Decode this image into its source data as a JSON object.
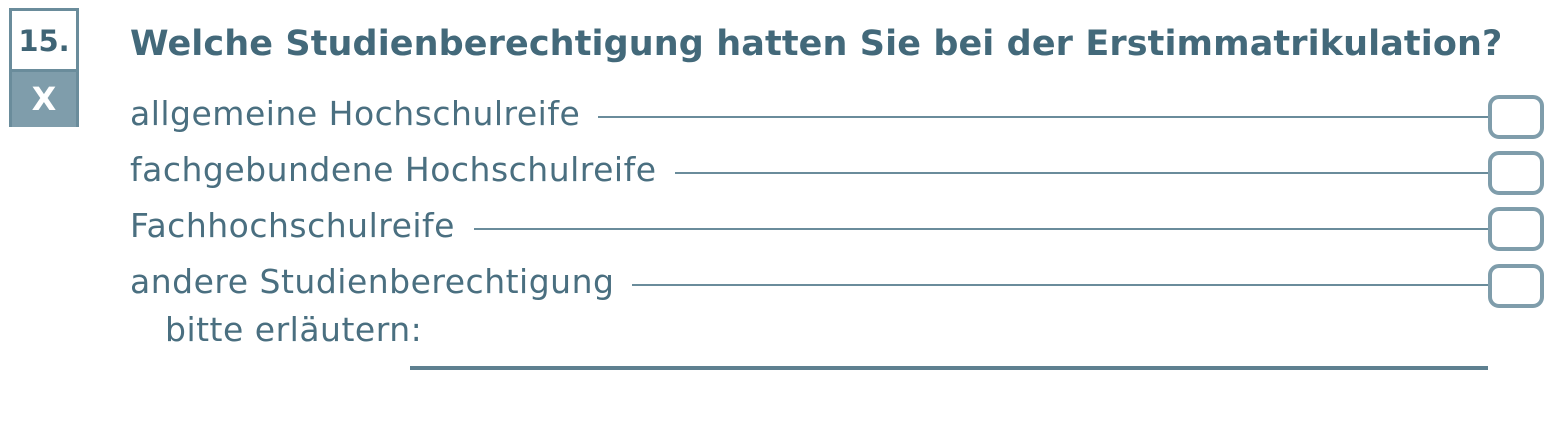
{
  "question": {
    "number": "15.",
    "mark": "X",
    "text": "Welche Studienberechtigung hatten Sie bei der Erstimmatrikulation?"
  },
  "options": [
    {
      "label": "allgemeine Hochschulreife",
      "checked": false
    },
    {
      "label": "fachgebundene Hochschulreife",
      "checked": false
    },
    {
      "label": "Fachhochschulreife",
      "checked": false
    },
    {
      "label": "andere Studienberechtigung",
      "checked": false
    }
  ],
  "explain": {
    "label": "bitte erläutern:",
    "value": ""
  },
  "colors": {
    "text": "#4a6f80",
    "heading": "#43697a",
    "badge_fill": "#7f9dab",
    "border": "#6a8c9b"
  }
}
